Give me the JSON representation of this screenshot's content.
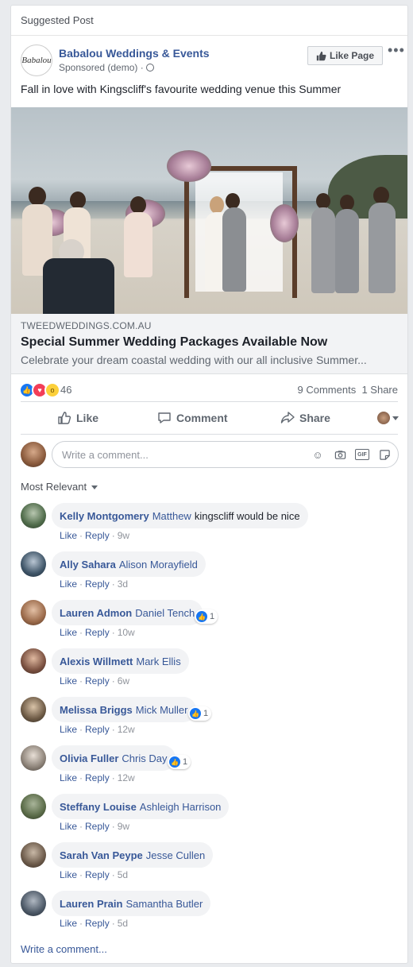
{
  "suggested_label": "Suggested Post",
  "page": {
    "name": "Babalou Weddings & Events",
    "logo_text": "Babalou",
    "sponsored": "Sponsored (demo) ·",
    "like_page_label": "Like Page",
    "more_label": "•••"
  },
  "post_text": "Fall in love with Kingscliff's favourite wedding venue this Summer",
  "link": {
    "domain": "TWEEDWEDDINGS.COM.AU",
    "title": "Special Summer Wedding Packages Available Now",
    "description": "Celebrate your dream coastal wedding with our all inclusive Summer..."
  },
  "reactions": {
    "count": "46",
    "comments": "9 Comments",
    "shares": "1 Share",
    "types": [
      "like",
      "love",
      "wow"
    ]
  },
  "actions": {
    "like": "Like",
    "comment": "Comment",
    "share": "Share"
  },
  "composer": {
    "placeholder": "Write a comment...",
    "icons": [
      "emoji-icon",
      "camera-icon",
      "gif-icon",
      "sticker-icon"
    ]
  },
  "sort_label": "Most Relevant",
  "comment_actions": {
    "like": "Like",
    "reply": "Reply"
  },
  "comments": [
    {
      "name": "Kelly Montgomery",
      "tag": "Matthew",
      "text": "kingscliff would be nice",
      "time": "9w",
      "likes": ""
    },
    {
      "name": "Ally Sahara",
      "tag": "Alison Morayfield",
      "text": "",
      "time": "3d",
      "likes": ""
    },
    {
      "name": "Lauren Admon",
      "tag": "Daniel Tench",
      "text": "",
      "time": "10w",
      "likes": "1"
    },
    {
      "name": "Alexis Willmett",
      "tag": "Mark Ellis",
      "text": "",
      "time": "6w",
      "likes": ""
    },
    {
      "name": "Melissa Briggs",
      "tag": "Mick Muller",
      "text": "",
      "time": "12w",
      "likes": "1"
    },
    {
      "name": "Olivia Fuller",
      "tag": "Chris Day",
      "text": "",
      "time": "12w",
      "likes": "1"
    },
    {
      "name": "Steffany Louise",
      "tag": "Ashleigh Harrison",
      "text": "",
      "time": "9w",
      "likes": ""
    },
    {
      "name": "Sarah Van Peype",
      "tag": "Jesse Cullen",
      "text": "",
      "time": "5d",
      "likes": ""
    },
    {
      "name": "Lauren Prain",
      "tag": "Samantha Butler",
      "text": "",
      "time": "5d",
      "likes": ""
    }
  ],
  "write_link": "Write a comment...",
  "colors": {
    "link_blue": "#385898",
    "background": "#e9ebee",
    "like_blue": "#1877f2",
    "love_red": "#f33e58",
    "wow_yellow": "#fcd03a"
  }
}
